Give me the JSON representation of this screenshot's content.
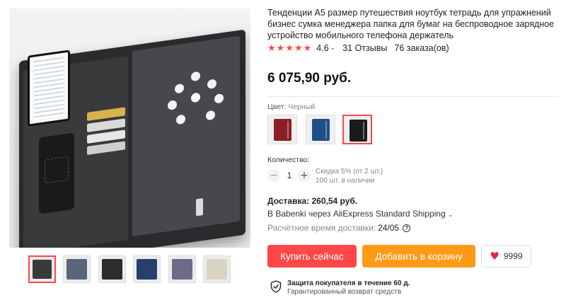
{
  "product": {
    "title": "Тенденции A5 размер путешествия ноутбук тетрадь для упражнений бизнес сумка менеджера папка для бумаг на беспроводное зарядное устройство мобильного телефона держатель",
    "rating": "4.6",
    "reviews": "31 Отзывы",
    "orders": "76 заказа(ов)",
    "price": "6 075,90 руб."
  },
  "colors": {
    "label": "Цвет:",
    "selected": "Черный",
    "swatches": [
      {
        "name": "red",
        "color": "#8b1f25"
      },
      {
        "name": "blue",
        "color": "#1f4e86"
      },
      {
        "name": "black",
        "color": "#1b1b1b"
      }
    ]
  },
  "quantity": {
    "label": "Количество:",
    "minus": "−",
    "value": "1",
    "plus": "+",
    "discount": "Скидка 5% (от 2 шт.)",
    "stock": "100 шт. в наличии"
  },
  "delivery": {
    "title": "Доставка: 260,54 руб.",
    "via": "В Babenki через AliExpress Standard Shipping",
    "time_label": "Расчётное время доставки:",
    "time_value": "24/05"
  },
  "actions": {
    "buy": "Купить сейчас",
    "cart": "Добавить в корзину",
    "wishlist_count": "9999"
  },
  "protection": {
    "title": "Защита покупателя в течение 60 д.",
    "subtitle": "Гарантированный возврат средств"
  },
  "gallery": {
    "thumbnails": [
      "#3a3a3d",
      "#596578",
      "#2c2c2e",
      "#24406b",
      "#6c6c88",
      "#d9d3c4"
    ]
  },
  "colors_theme": {
    "accent": "#ff4747",
    "cart": "#ff9a17"
  }
}
